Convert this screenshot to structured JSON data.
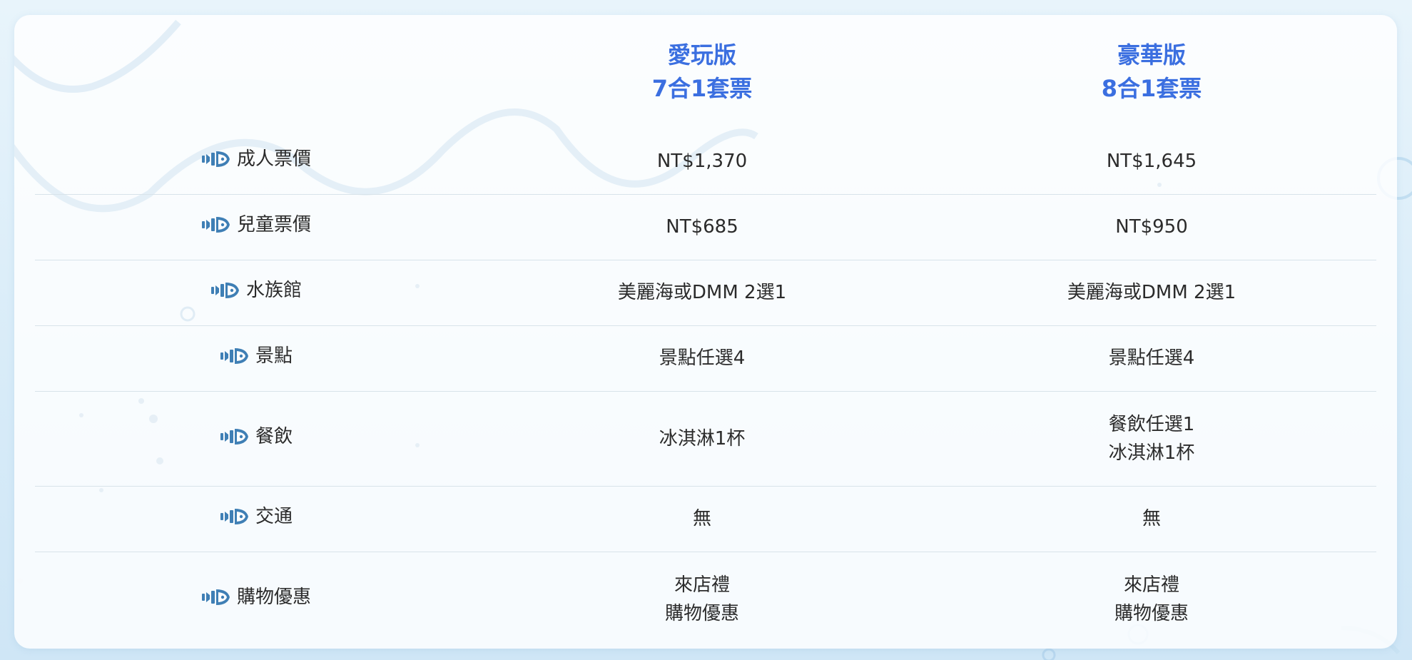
{
  "columns": [
    {
      "line1": "愛玩版",
      "line2": "7合1套票"
    },
    {
      "line1": "豪華版",
      "line2": "8合1套票"
    }
  ],
  "rows": [
    {
      "label": "成人票價",
      "icon": "fish-icon",
      "values": [
        [
          "NT$1,370"
        ],
        [
          "NT$1,645"
        ]
      ]
    },
    {
      "label": "兒童票價",
      "icon": "fish-icon",
      "values": [
        [
          "NT$685"
        ],
        [
          "NT$950"
        ]
      ]
    },
    {
      "label": "水族館",
      "icon": "fish-icon",
      "values": [
        [
          "美麗海或DMM 2選1"
        ],
        [
          "美麗海或DMM 2選1"
        ]
      ]
    },
    {
      "label": "景點",
      "icon": "fish-icon",
      "values": [
        [
          "景點任選4"
        ],
        [
          "景點任選4"
        ]
      ]
    },
    {
      "label": "餐飲",
      "icon": "fish-icon",
      "values": [
        [
          "冰淇淋1杯"
        ],
        [
          "餐飲任選1",
          "冰淇淋1杯"
        ]
      ]
    },
    {
      "label": "交通",
      "icon": "fish-icon",
      "values": [
        [
          "無"
        ],
        [
          "無"
        ]
      ]
    },
    {
      "label": "購物優惠",
      "icon": "fish-icon",
      "values": [
        [
          "來店禮",
          "購物優惠"
        ],
        [
          "來店禮",
          "購物優惠"
        ]
      ]
    }
  ],
  "colors": {
    "header_text": "#3b6fe0",
    "body_text": "#2b2b2b",
    "icon": "#3f7fb5",
    "row_divider": "#d8e3ea",
    "background": "#e8f4fb"
  }
}
